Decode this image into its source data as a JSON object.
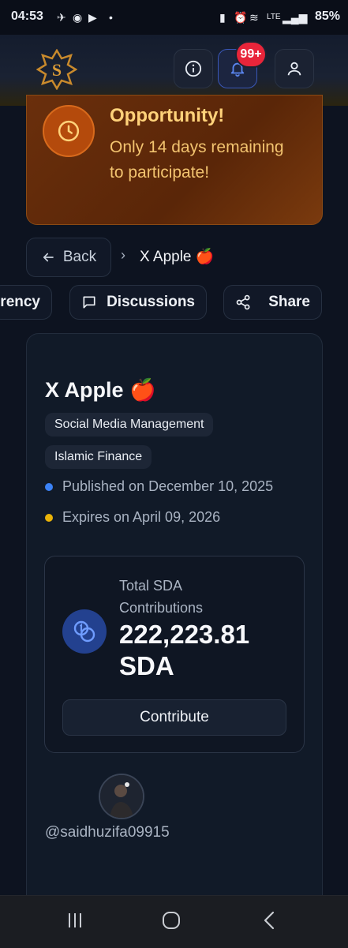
{
  "status_bar": {
    "time": "04:53",
    "battery": "85%"
  },
  "header": {
    "notification_badge": "99+"
  },
  "banner": {
    "title": "Opportunity!",
    "text": "Only 14 days remaining to participate!"
  },
  "breadcrumb": {
    "back_label": "Back",
    "separator": "›",
    "current": "X Apple 🍎"
  },
  "actions": {
    "transparency_partial": "rency",
    "discussions": "Discussions",
    "share": "Share"
  },
  "project": {
    "title": "X Apple 🍎",
    "tags": [
      "Social Media Management",
      "Islamic Finance"
    ],
    "published": "Published on December 10, 2025",
    "expires": "Expires on April 09, 2026"
  },
  "contributions": {
    "label": "Total SDA Contributions",
    "amount": "222,223.81 SDA",
    "button": "Contribute"
  },
  "author": {
    "handle": "@saidhuzifa09915"
  },
  "colors": {
    "published_dot": "#3b82f6",
    "expires_dot": "#eab308",
    "banner_title": "#ffd27a",
    "badge": "#e8253a"
  }
}
